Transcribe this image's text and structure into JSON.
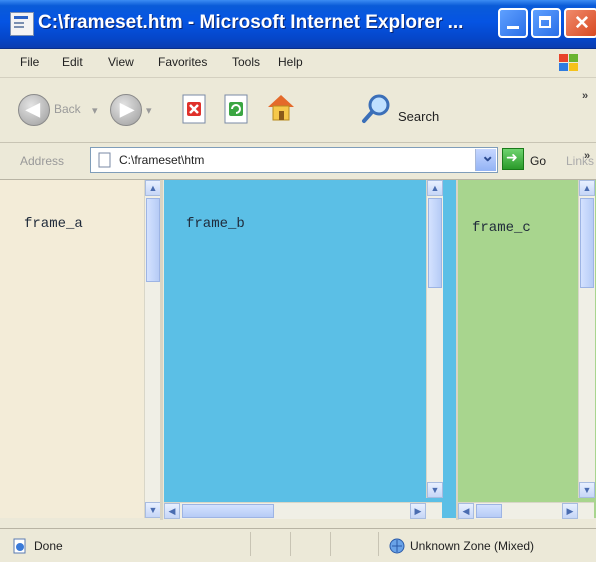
{
  "window": {
    "title": "C:\\frameset.htm - Microsoft Internet Explorer ..."
  },
  "menu": {
    "items": [
      "File",
      "Edit",
      "View",
      "Favorites",
      "Tools",
      "Help"
    ]
  },
  "toolbar": {
    "back_label": "Back",
    "search_label": "Search",
    "more": "»"
  },
  "address": {
    "label": "Address",
    "value": "C:\\frameset\\htm",
    "go_label": "Go",
    "links_label": "Links",
    "more": "»"
  },
  "frames": {
    "frame_a": "frame_a",
    "frame_b": "frame_b",
    "frame_c": "frame_c"
  },
  "colors": {
    "frame_a_bg": "#f3ecd8",
    "frame_b_bg": "#5bbfe6",
    "frame_c_bg": "#a8d58e",
    "titlebar": "#0554e3"
  },
  "status": {
    "text": "Done",
    "zone": "Unknown Zone (Mixed)"
  }
}
